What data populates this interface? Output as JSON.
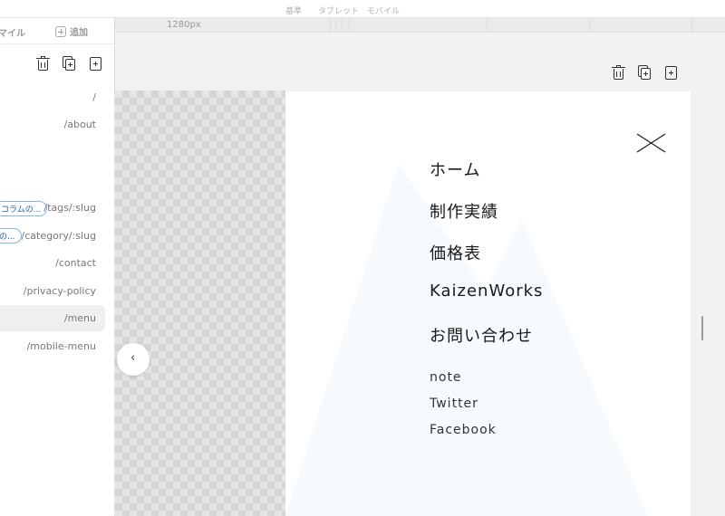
{
  "breakpoints": {
    "base": "基準",
    "tablet": "タブレット",
    "mobile": "モバイル"
  },
  "ruler": {
    "width_label": "1280px"
  },
  "sidebar": {
    "mode_label": "マイル",
    "add_label": "追加",
    "routes": [
      {
        "path": "/"
      },
      {
        "path": "/about"
      },
      {
        "path": "/tags/:slug",
        "tag": "コラムの..."
      },
      {
        "path": "/category/:slug",
        "tag": "の..."
      },
      {
        "path": "/contact"
      },
      {
        "path": "/privacy-policy"
      },
      {
        "path": "/menu",
        "active": true
      },
      {
        "path": "/mobile-menu"
      }
    ]
  },
  "collapse": {
    "glyph": "‹"
  },
  "menu": {
    "main_items": [
      "ホーム",
      "制作実績",
      "価格表",
      "KaizenWorks",
      "お問い合わせ"
    ],
    "sub_items": [
      "note",
      "Twitter",
      "Facebook"
    ]
  },
  "colors": {
    "accent_tag": "#1a5fb4",
    "mountain_bg": "#f4fafd"
  }
}
